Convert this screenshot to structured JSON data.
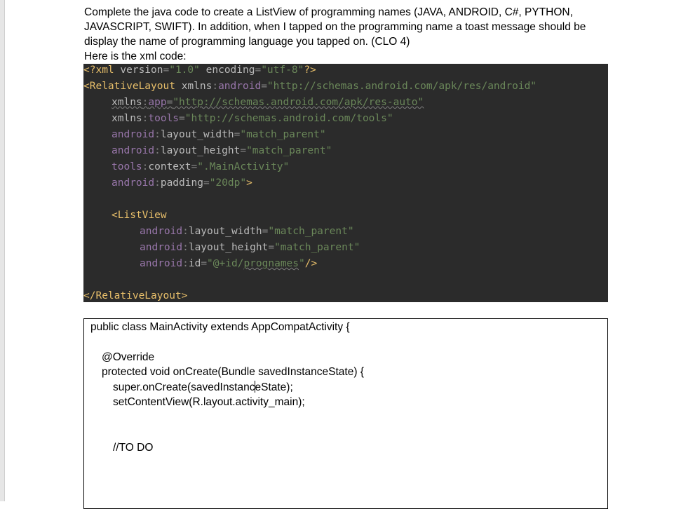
{
  "question": {
    "line1": "Complete the java code to create a ListView of programming names (JAVA, ANDROID, C#, PYTHON,",
    "line2": "JAVASCRIPT, SWIFT). In addition, when I tapped on the programming name a toast message should be",
    "line3": "display the name of programming language you tapped on. (CLO 4)",
    "line4": "Here is the xml code:"
  },
  "xml": {
    "decl_open": "<?xml ",
    "decl_version_attr": "version",
    "decl_version_val": "\"1.0\"",
    "decl_encoding_attr": "encoding",
    "decl_encoding_val": "\"utf-8\"",
    "decl_close": "?>",
    "rl_open": "<RelativeLayout ",
    "ns_xmlns": "xmlns",
    "ns_android": "android",
    "ns_app": "app",
    "ns_tools": "tools",
    "android_ns_val": "\"http://schemas.android.com/apk/res/android\"",
    "app_ns_val": "\"http://schemas.android.com/apk/res-auto\"",
    "tools_ns_val": "\"http://schemas.android.com/tools\"",
    "attr_layout_width": "layout_width",
    "attr_layout_height": "layout_height",
    "attr_context": "context",
    "attr_padding": "padding",
    "attr_id": "id",
    "val_match_parent": "\"match_parent\"",
    "val_context": "\".MainActivity\"",
    "val_padding": "\"20dp\"",
    "listview_open": "<ListView",
    "val_id_pre": "\"@+id/",
    "val_id_name": "prognames",
    "val_id_post": "\"",
    "selfclose": "/>",
    "rl_close": "</RelativeLayout>"
  },
  "java": {
    "l1": "public class MainActivity extends AppCompatActivity {",
    "l2": "@Override",
    "l3": "protected void onCreate(Bundle savedInstanceState) {",
    "l4a": "super.onCreate(savedInstanc",
    "l4b": "eState);",
    "l5": "setContentView(R.layout.activity_main);",
    "l6": "//TO DO"
  },
  "colors": {
    "code_bg": "#2b2b2b",
    "tag": "#e8bf6a",
    "namespace": "#9876aa",
    "string": "#6a8759",
    "text": "#a9b7c6"
  }
}
